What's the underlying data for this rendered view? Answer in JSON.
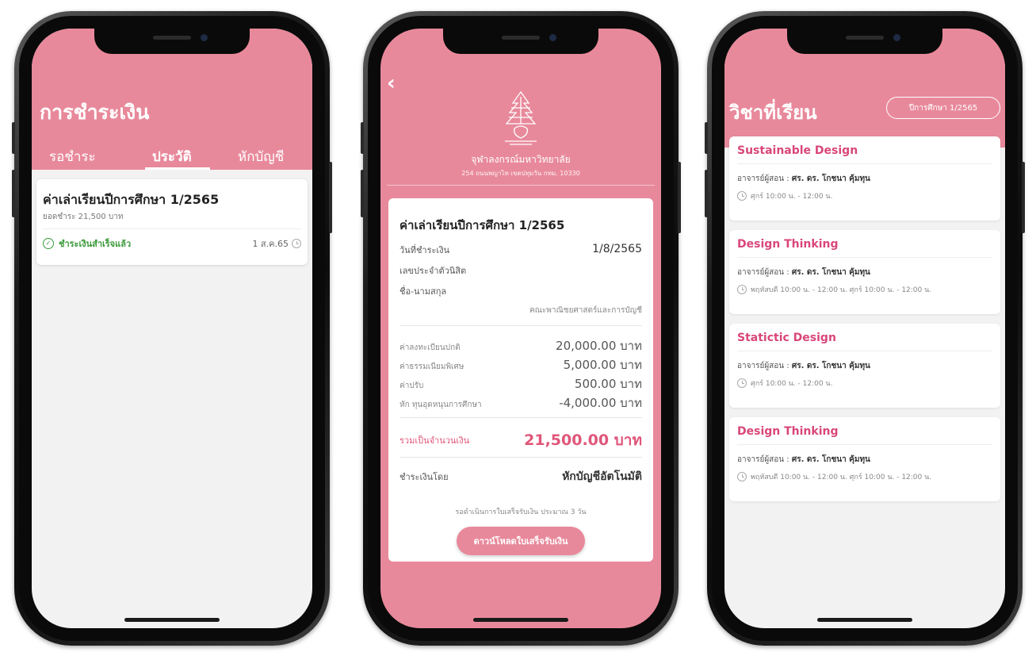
{
  "colors": {
    "accent": "#e8899b",
    "highlight": "#d9467a",
    "success": "#3a9a3a"
  },
  "phone1": {
    "title": "การชำระเงิน",
    "tabs": [
      "รอชำระ",
      "ประวัติ",
      "หักบัญชี"
    ],
    "active_tab": "ประวัติ",
    "card": {
      "title": "ค่าเล่าเรียนปีการศึกษา 1/2565",
      "subtitle": "ยอดชำระ 21,500 บาท",
      "status": "ชำระเงินสำเร็จแล้ว",
      "date": "1 ส.ค.65"
    }
  },
  "phone2": {
    "back_icon": "chevron-left-icon",
    "university": "จุฬาลงกรณ์มหาวิทยาลัย",
    "address": "254 ถนนพญาไท เขตปทุมวัน กทม. 10330",
    "card": {
      "title": "ค่าเล่าเรียนปีการศึกษา 1/2565",
      "pay_date_label": "วันที่ชำระเงิน",
      "pay_date": "1/8/2565",
      "student_id_label": "เลขประจำตัวนิสิต",
      "name_label": "ชื่อ-นามสกุล",
      "faculty": "คณะพาณิชยศาสตร์และการบัญชี",
      "fees": [
        {
          "label": "ค่าลงทะเบียนปกติ",
          "value": "20,000.00 บาท"
        },
        {
          "label": "ค่าธรรมเนียมพิเศษ",
          "value": "5,000.00 บาท"
        },
        {
          "label": "ค่าปรับ",
          "value": "500.00 บาท"
        },
        {
          "label": "หัก ทุนอุดหนุนการศึกษา",
          "value": "-4,000.00 บาท"
        }
      ],
      "total_label": "รวมเป็นจำนวนเงิน",
      "total_value": "21,500.00 บาท",
      "payby_label": "ชำระเงินโดย",
      "payby_value": "หักบัญชีอัตโนมัติ",
      "note": "รอดำเนินการใบเสร็จรับเงิน ประมาณ 3 วัน",
      "download_label": "ดาวน์โหลดใบเสร็จรับเงิน"
    }
  },
  "phone3": {
    "title": "วิชาที่เรียน",
    "term_label": "ปีการศึกษา 1/2565",
    "courses": [
      {
        "name": "Sustainable Design",
        "teacher_label": "อาจารย์ผู้สอน :",
        "teacher": "ศร. ดร. โกชนา คุ้มทุน",
        "time": "ศุกร์ 10:00 น. - 12:00 น."
      },
      {
        "name": "Design Thinking",
        "teacher_label": "อาจารย์ผู้สอน :",
        "teacher": "ศร. ดร. โกชนา คุ้มทุน",
        "time": "พฤหัสบดี 10:00 น. - 12:00 น. ศุกร์ 10:00 น. - 12:00 น."
      },
      {
        "name": "Statictic Design",
        "teacher_label": "อาจารย์ผู้สอน :",
        "teacher": "ศร. ดร. โกชนา คุ้มทุน",
        "time": "ศุกร์ 10:00 น. - 12:00 น."
      },
      {
        "name": "Design Thinking",
        "teacher_label": "อาจารย์ผู้สอน :",
        "teacher": "ศร. ดร. โกชนา คุ้มทุน",
        "time": "พฤหัสบดี 10:00 น. - 12:00 น. ศุกร์ 10:00 น. - 12:00 น."
      }
    ]
  }
}
